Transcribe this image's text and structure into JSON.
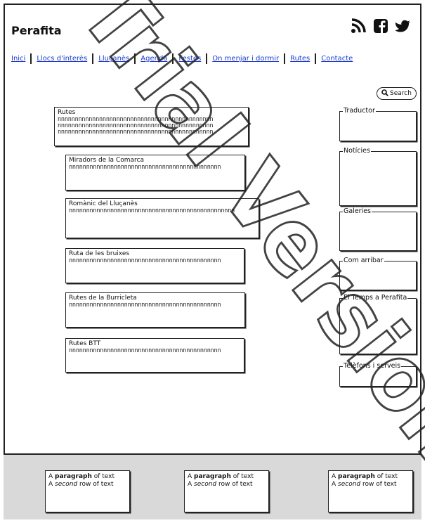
{
  "header": {
    "title": "Perafita",
    "social_icons": [
      "rss-icon",
      "facebook-icon",
      "twitter-icon"
    ]
  },
  "nav": [
    {
      "label": "Inici"
    },
    {
      "label": "Llocs d'interès"
    },
    {
      "label": "Lluçanès"
    },
    {
      "label": "Agenda"
    },
    {
      "label": "Festes"
    },
    {
      "label": "On menjar i dormir"
    },
    {
      "label": "Rutes"
    },
    {
      "label": "Contacte"
    }
  ],
  "search": {
    "label": "Search"
  },
  "main": {
    "rutes": {
      "title": "Rutes",
      "lines": [
        "nnnnnnnnnnnnnnnnnnnnnnnnnnnnnnnnnnnnnnnnnnnnn",
        "nnnnnnnnnnnnnnnnnnnnnnnnnnnnnnnnnnnnnnnnnnnnn",
        "nnnnnnnnnnnnnnnnnnnnnnnnnnnnnnnnnnnnnnnnnnnnn"
      ]
    },
    "routes": [
      {
        "title": "Miradors de la Comarca",
        "line": "nnnnnnnnnnnnnnnnnnnnnnnnnnnnnnnnnnnnnnnnnnnn"
      },
      {
        "title": "Romànic del Lluçanès",
        "line": "nnnnnnnnnnnnnnnnnnnnnnnnnnnnnnnnnnnnnnnnnnnnnnnn"
      },
      {
        "title": "Ruta de les bruixes",
        "line": "nnnnnnnnnnnnnnnnnnnnnnnnnnnnnnnnnnnnnnnnnnnn"
      },
      {
        "title": "Rutes de la Burricleta",
        "line": "nnnnnnnnnnnnnnnnnnnnnnnnnnnnnnnnnnnnnnnnnnnn"
      },
      {
        "title": "Rutes BTT",
        "line": "nnnnnnnnnnnnnnnnnnnnnnnnnnnnnnnnnnnnnnnnnnnn"
      }
    ]
  },
  "sidebar": [
    {
      "label": "Traductor"
    },
    {
      "label": "Notícies"
    },
    {
      "label": "Galeries"
    },
    {
      "label": "Com arribar"
    },
    {
      "label": "El Temps a Perafita"
    },
    {
      "label": "Telèfons i serveis"
    }
  ],
  "footer": {
    "p_prefix": "A ",
    "p_bold": "paragraph",
    "p_suffix": " of text",
    "s_prefix": "A ",
    "s_italic": "second",
    "s_suffix": " row of text"
  },
  "watermark": "Trial Version"
}
